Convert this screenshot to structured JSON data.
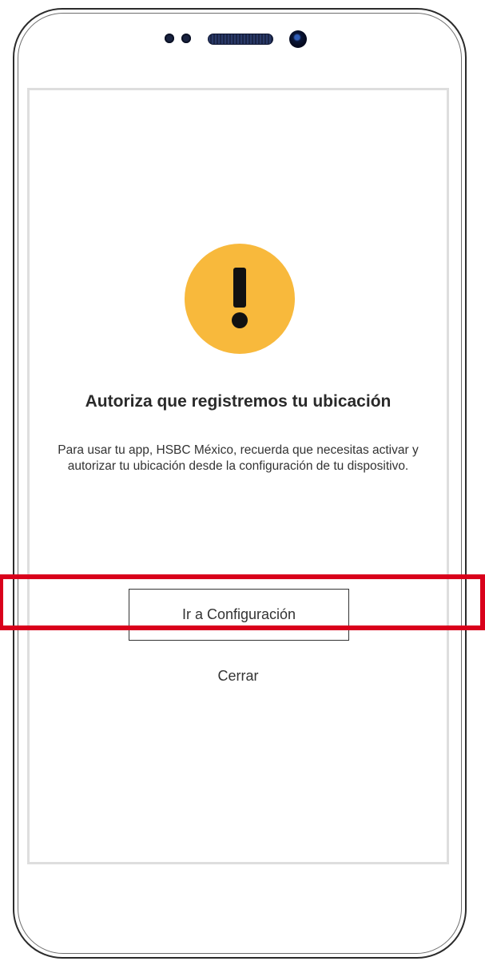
{
  "dialog": {
    "title": "Autoriza que registremos tu ubicación",
    "message": "Para usar tu app, HSBC México, recuerda que necesitas activar y autorizar tu ubicación desde la configuración de tu dispositivo.",
    "primary_button_label": "Ir a Configuración",
    "secondary_link_label": "Cerrar"
  },
  "icons": {
    "warning": "warning-exclamation-icon"
  },
  "colors": {
    "warning_icon_bg": "#f8b93c",
    "highlight_border": "#d9001b",
    "text": "#333333"
  }
}
